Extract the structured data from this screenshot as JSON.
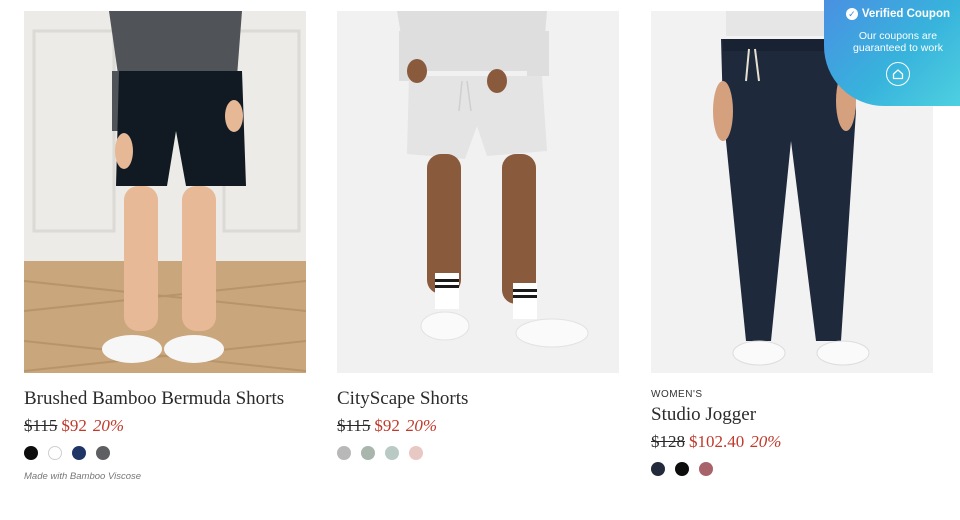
{
  "products": [
    {
      "title": "Brushed Bamboo Bermuda Shorts",
      "tag": "",
      "price_old": "$115",
      "price_new": "$92",
      "discount": "20%",
      "note": "Made with Bamboo Viscose",
      "swatches": [
        "#0d0d0d",
        "#ffffff",
        "#1f3566",
        "#5d5f62"
      ]
    },
    {
      "title": "CityScape Shorts",
      "tag": "",
      "price_old": "$115",
      "price_new": "$92",
      "discount": "20%",
      "note": "",
      "swatches": [
        "#b8b8b8",
        "#a8b6ad",
        "#b9c9c4",
        "#e8c8c2"
      ]
    },
    {
      "title": "Studio Jogger",
      "tag": "WOMEN'S",
      "price_old": "$128",
      "price_new": "$102.40",
      "discount": "20%",
      "note": "",
      "swatches": [
        "#232a3b",
        "#0d0d0d",
        "#a7626a"
      ]
    }
  ],
  "coupon": {
    "title": "Verified Coupon",
    "subtitle": "Our coupons are guaranteed to work"
  },
  "colors": {
    "sale_red": "#c0392b",
    "coupon_gradient_start": "#4a90e2",
    "coupon_gradient_end": "#4fd0e0"
  },
  "icons": [
    "check-icon",
    "home-icon"
  ]
}
